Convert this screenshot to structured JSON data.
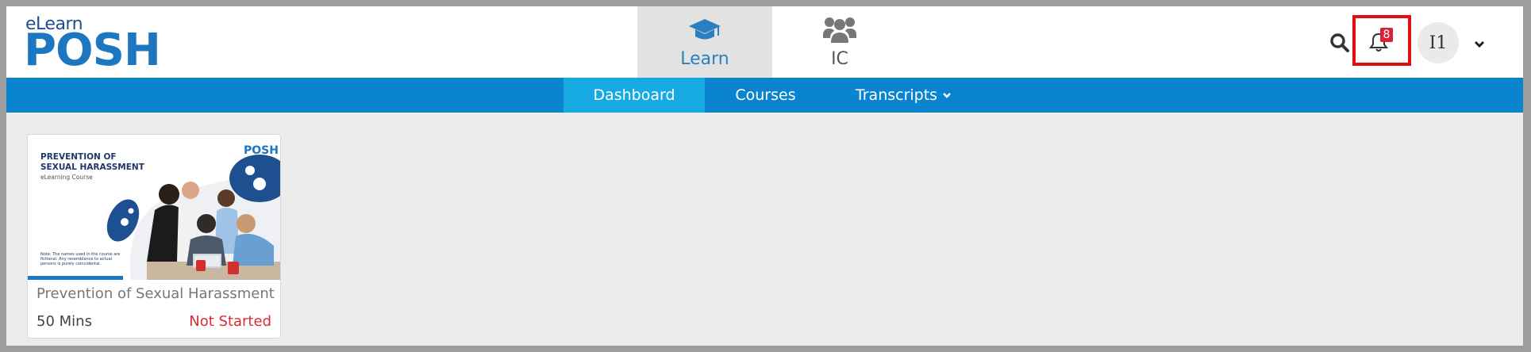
{
  "logo": {
    "small": "eLearn",
    "big": "POSH"
  },
  "top_nav": {
    "tabs": [
      {
        "label": "Learn",
        "icon": "graduation-cap-icon",
        "active": true
      },
      {
        "label": "IC",
        "icon": "users-group-icon",
        "active": false
      }
    ]
  },
  "header": {
    "search_icon": "search-icon",
    "notifications_count": "8",
    "avatar_initials": "I1"
  },
  "sub_nav": {
    "items": [
      {
        "label": "Dashboard",
        "active": true
      },
      {
        "label": "Courses",
        "active": false
      },
      {
        "label": "Transcripts",
        "active": false,
        "dropdown": true
      }
    ]
  },
  "course_card": {
    "thumbnail": {
      "title_line1": "PREVENTION OF",
      "title_line2": "SEXUAL HARASSMENT",
      "subtitle": "eLearning Course",
      "logo": "POSH",
      "note": "Note: The names used in the course are fictional. Any resemblance to actual persons is purely coincidental."
    },
    "title": "Prevention of Sexual Harassment",
    "duration": "50 Mins",
    "status": "Not Started"
  },
  "colors": {
    "primary_blue": "#0a84cf",
    "active_subnav": "#17a9e1",
    "active_tab_text": "#2b7fbf",
    "status_red": "#d92b35",
    "highlight_box": "#e01010"
  }
}
